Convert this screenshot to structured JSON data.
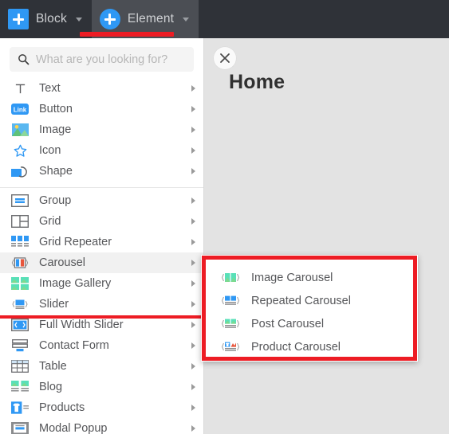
{
  "topbar": {
    "block_button": {
      "label": "Block",
      "icon": "plus-square-icon",
      "caret": "chevron-down-icon"
    },
    "element_button": {
      "label": "Element",
      "icon": "plus-circle-icon",
      "caret": "chevron-down-icon",
      "active": true
    },
    "highlight_color": "#ed1c24",
    "background_color": "#2f3238",
    "accent_color": "#2f98f4"
  },
  "search": {
    "icon": "search-icon",
    "value": "",
    "placeholder": "What are you looking for?"
  },
  "menu": {
    "group_one": [
      {
        "label": "Text",
        "icon": "text-t-icon",
        "arrow": "chevron-right-icon"
      },
      {
        "label": "Button",
        "icon": "link-button-icon",
        "arrow": "chevron-right-icon"
      },
      {
        "label": "Image",
        "icon": "image-icon",
        "arrow": "chevron-right-icon"
      },
      {
        "label": "Icon",
        "icon": "star-icon",
        "arrow": "chevron-right-icon"
      },
      {
        "label": "Shape",
        "icon": "shape-icon",
        "arrow": "chevron-right-icon"
      }
    ],
    "group_two": [
      {
        "label": "Group",
        "icon": "group-icon",
        "arrow": "chevron-right-icon"
      },
      {
        "label": "Grid",
        "icon": "grid-icon",
        "arrow": "chevron-right-icon"
      },
      {
        "label": "Grid Repeater",
        "icon": "grid-repeater-icon",
        "arrow": "chevron-right-icon"
      },
      {
        "label": "Carousel",
        "icon": "carousel-icon",
        "arrow": "chevron-right-icon",
        "highlighted": true
      },
      {
        "label": "Image Gallery",
        "icon": "image-gallery-icon",
        "arrow": "chevron-right-icon"
      },
      {
        "label": "Slider",
        "icon": "slider-icon",
        "arrow": "chevron-right-icon"
      },
      {
        "label": "Full Width Slider",
        "icon": "full-width-slider-icon",
        "arrow": "chevron-right-icon"
      },
      {
        "label": "Contact Form",
        "icon": "contact-form-icon",
        "arrow": "chevron-right-icon"
      },
      {
        "label": "Table",
        "icon": "table-icon",
        "arrow": "chevron-right-icon"
      },
      {
        "label": "Blog",
        "icon": "blog-icon",
        "arrow": "chevron-right-icon"
      },
      {
        "label": "Products",
        "icon": "products-icon",
        "arrow": "chevron-right-icon"
      },
      {
        "label": "Modal Popup",
        "icon": "modal-popup-icon",
        "arrow": "chevron-right-icon"
      }
    ]
  },
  "submenu": {
    "border_color": "#ed1c24",
    "items": [
      {
        "label": "Image Carousel",
        "icon": "image-carousel-icon"
      },
      {
        "label": "Repeated Carousel",
        "icon": "repeated-carousel-icon"
      },
      {
        "label": "Post Carousel",
        "icon": "post-carousel-icon"
      },
      {
        "label": "Product Carousel",
        "icon": "product-carousel-icon"
      }
    ]
  },
  "canvas": {
    "close_icon": "close-x-icon",
    "page_title": "Home",
    "background_color": "#e3e3e3"
  }
}
